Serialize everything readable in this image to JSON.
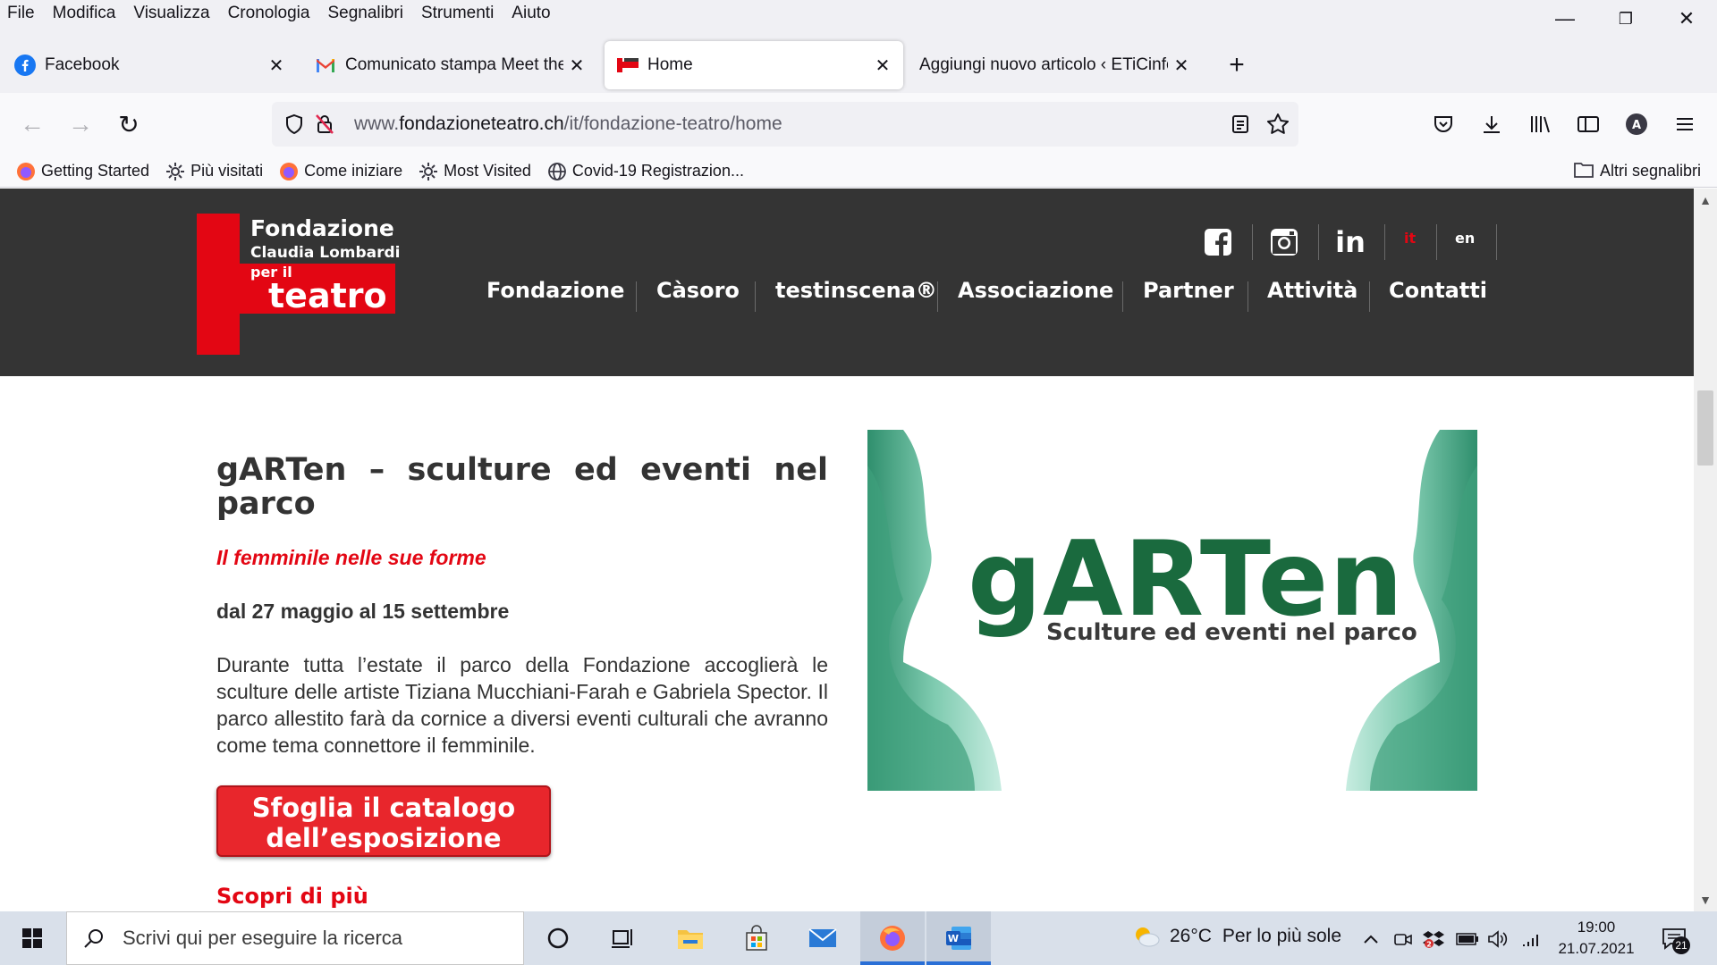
{
  "menu": [
    "File",
    "Modifica",
    "Visualizza",
    "Cronologia",
    "Segnalibri",
    "Strumenti",
    "Aiuto"
  ],
  "window_controls": {
    "minimize": "—",
    "restore": "❐",
    "close": "✕"
  },
  "tabs": [
    {
      "title": "Facebook",
      "icon": "facebook-icon",
      "active": false
    },
    {
      "title": "Comunicato stampa Meet the a",
      "icon": "gmail-icon",
      "active": false
    },
    {
      "title": "Home",
      "icon": "fondazione-favicon",
      "active": true
    },
    {
      "title": "Aggiungi nuovo articolo ‹ ETiCinforr",
      "icon": "none",
      "active": false
    }
  ],
  "tab_close": "✕",
  "new_tab": "+",
  "nav": {
    "back": "←",
    "forward": "→",
    "reload": "↻",
    "url_prefix": "www.",
    "url_domain": "fondazioneteatro.ch",
    "url_path": "/it/fondazione-teatro/home"
  },
  "bookmarks": [
    {
      "label": "Getting Started",
      "icon": "firefox-icon"
    },
    {
      "label": "Più visitati",
      "icon": "gear-icon"
    },
    {
      "label": "Come iniziare",
      "icon": "firefox-icon"
    },
    {
      "label": "Most Visited",
      "icon": "gear-icon"
    },
    {
      "label": "Covid-19 Registrazion...",
      "icon": "globe-icon"
    }
  ],
  "bookmarks_other": "Altri segnalibri",
  "site": {
    "logo": {
      "line1": "Fondazione",
      "line2": "Claudia Lombardi",
      "line3": "per il",
      "line4": "teatro"
    },
    "social": [
      "facebook",
      "instagram",
      "linkedin"
    ],
    "linkedin_text": "in",
    "languages": [
      {
        "code": "it",
        "active": true
      },
      {
        "code": "en",
        "active": false
      }
    ],
    "nav": [
      "Fondazione",
      "Càsoro",
      "testinscena®",
      "Associazione",
      "Partner",
      "Attività",
      "Contatti"
    ],
    "colors": {
      "header": "#343434",
      "brand_red": "#e30613",
      "garten_green": "#1a6a3e"
    }
  },
  "article": {
    "title": "gARTen – sculture ed eventi nel parco",
    "subtitle": "Il femminile nelle sue forme",
    "date": "dal 27 maggio al 15 settembre",
    "body": "Durante tutta l’estate il parco della Fondazione accoglierà le sculture delle artiste Tiziana Mucchiani-Farah e Gabriela Spector. Il parco allestito farà da cornice a diversi eventi culturali che avranno come tema connettore il femminile.",
    "button_line1": "Sfoglia il catalogo",
    "button_line2": "dell’esposizione",
    "more": "Scopri di più"
  },
  "hero": {
    "title": "gARTen",
    "subtitle": "Sculture ed eventi nel parco"
  },
  "taskbar": {
    "search_placeholder": "Scrivi qui per eseguire la ricerca",
    "weather_temp": "26°C",
    "weather_text": "Per lo più sole",
    "time": "19:00",
    "date": "21.07.2021",
    "notifications": "21"
  }
}
